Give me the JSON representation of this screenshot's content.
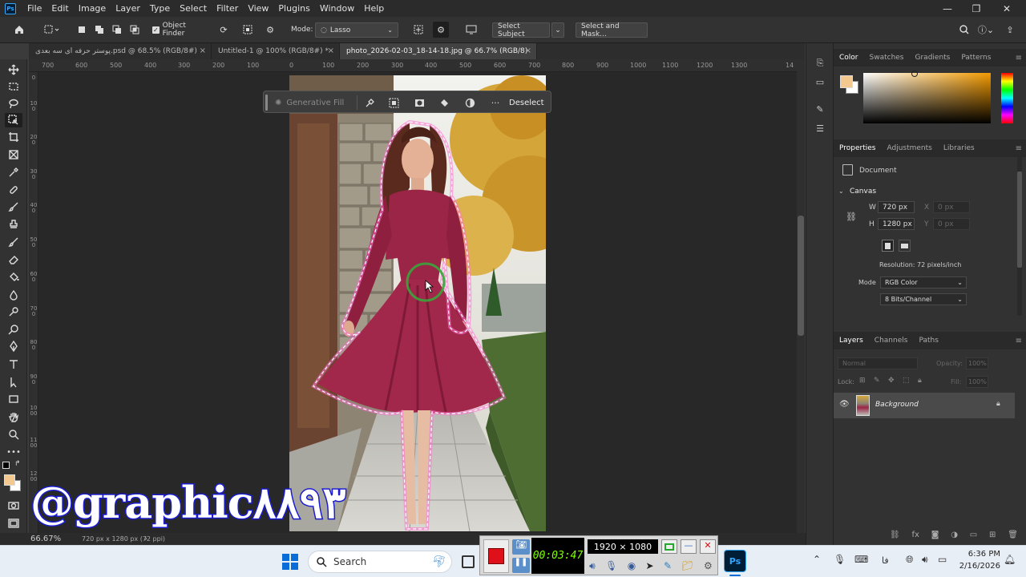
{
  "app": {
    "name": "Photoshop",
    "logo": "Ps"
  },
  "menu": [
    "File",
    "Edit",
    "Image",
    "Layer",
    "Type",
    "Select",
    "Filter",
    "View",
    "Plugins",
    "Window",
    "Help"
  ],
  "options_bar": {
    "object_finder": "Object Finder",
    "mode_label": "Mode:",
    "mode_value": "Lasso",
    "select_subject": "Select Subject",
    "select_and_mask": "Select and Mask..."
  },
  "doc_tabs": [
    {
      "label": "پوستر حرفه ای سه بعدی.psd @ 68.5% (RGB/8#) *",
      "active": false
    },
    {
      "label": "Untitled-1 @ 100% (RGB/8#) *",
      "active": false
    },
    {
      "label": "photo_2026-02-03_18-14-18.jpg @ 66.7% (RGB/8)",
      "active": true
    }
  ],
  "ruler_top": [
    "700",
    "600",
    "500",
    "400",
    "300",
    "200",
    "100",
    "0",
    "100",
    "200",
    "300",
    "400",
    "500",
    "600",
    "700",
    "800",
    "900",
    "1000",
    "1100",
    "1200",
    "1300",
    "14"
  ],
  "ruler_left": [
    "0",
    "100",
    "200",
    "300",
    "400",
    "500",
    "600",
    "700",
    "800",
    "900",
    "1000",
    "1100",
    "1200"
  ],
  "context_bar": {
    "generative_fill": "Generative Fill",
    "more": "···",
    "deselect": "Deselect"
  },
  "status": {
    "zoom": "66.67%",
    "info": "720 px x 1280 px (72 ppi)"
  },
  "color_panel": {
    "tabs": [
      "Color",
      "Swatches",
      "Gradients",
      "Patterns"
    ],
    "foreground": "#f3c98f",
    "hue": "#f39a00"
  },
  "properties_panel": {
    "tabs": [
      "Properties",
      "Adjustments",
      "Libraries"
    ],
    "doc_label": "Document",
    "canvas_label": "Canvas",
    "w_label": "W",
    "w_value": "720 px",
    "x_label": "X",
    "x_value": "0 px",
    "h_label": "H",
    "h_value": "1280 px",
    "y_label": "Y",
    "y_value": "0 px",
    "resolution": "Resolution: 72 pixels/inch",
    "mode_label": "Mode",
    "mode_value": "RGB Color",
    "bits_value": "8 Bits/Channel"
  },
  "layers_panel": {
    "tabs": [
      "Layers",
      "Channels",
      "Paths"
    ],
    "blend": "Normal",
    "opacity_label": "Opacity:",
    "opacity_value": "100%",
    "lock_label": "Lock:",
    "fill_label": "Fill:",
    "fill_value": "100%",
    "layer_name": "Background"
  },
  "recorder": {
    "timer": "00:03:47",
    "resolution": "1920 × 1080"
  },
  "taskbar": {
    "search": "Search",
    "lang": "فا",
    "time": "6:36 PM",
    "date": "2/16/2026"
  },
  "watermark": "@graphic۸۸۹۳"
}
